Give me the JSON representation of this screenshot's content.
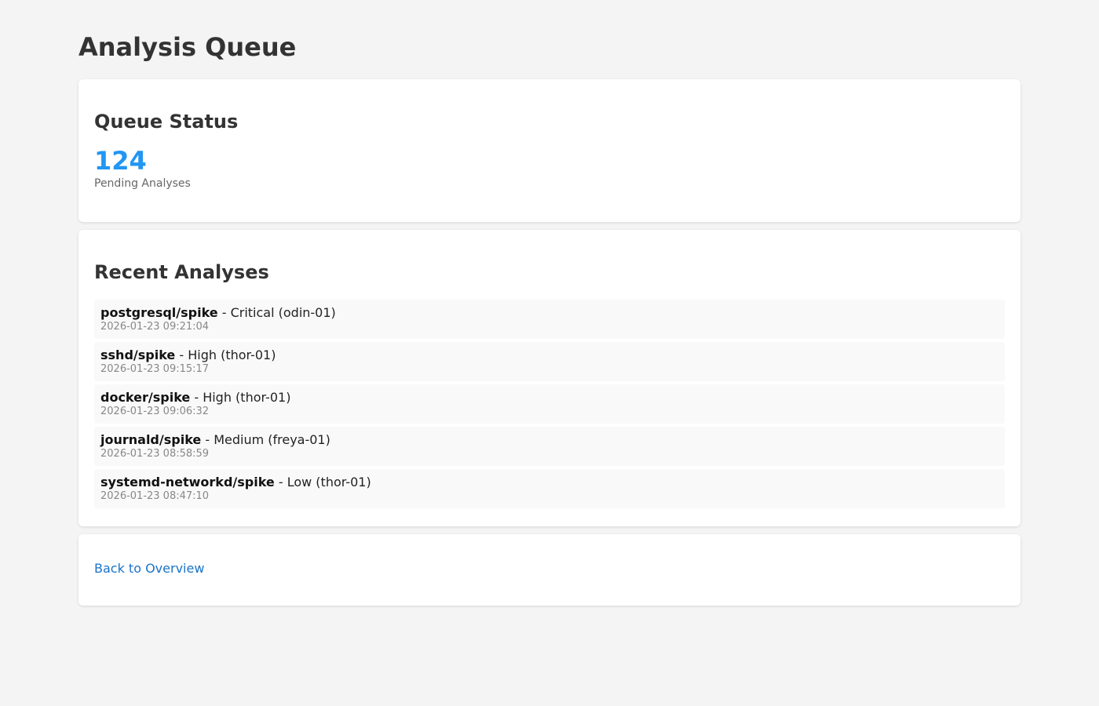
{
  "page": {
    "title": "Analysis Queue"
  },
  "queue_status": {
    "heading": "Queue Status",
    "pending_count": "124",
    "pending_label": "Pending Analyses"
  },
  "recent": {
    "heading": "Recent Analyses",
    "items": [
      {
        "name": "postgresql/spike",
        "detail": " - Critical (odin-01)",
        "timestamp": "2026-01-23 09:21:04"
      },
      {
        "name": "sshd/spike",
        "detail": " - High (thor-01)",
        "timestamp": "2026-01-23 09:15:17"
      },
      {
        "name": "docker/spike",
        "detail": " - High (thor-01)",
        "timestamp": "2026-01-23 09:06:32"
      },
      {
        "name": "journald/spike",
        "detail": " - Medium (freya-01)",
        "timestamp": "2026-01-23 08:58:59"
      },
      {
        "name": "systemd-networkd/spike",
        "detail": " - Low (thor-01)",
        "timestamp": "2026-01-23 08:47:10"
      }
    ]
  },
  "nav": {
    "back_label": "Back to Overview"
  },
  "colors": {
    "accent": "#2196f3",
    "link": "#1a73c8",
    "background": "#f4f4f4"
  }
}
